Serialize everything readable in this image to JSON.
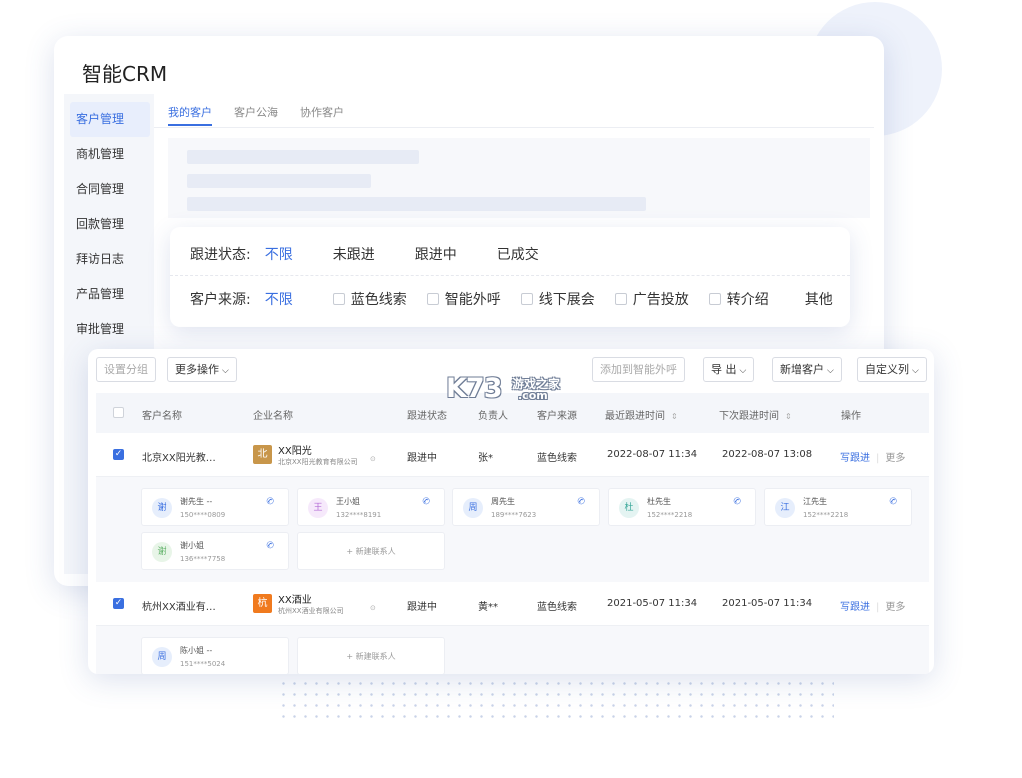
{
  "app": {
    "title": "智能CRM"
  },
  "sidebar": {
    "items": [
      {
        "label": "客户管理",
        "active": true
      },
      {
        "label": "商机管理"
      },
      {
        "label": "合同管理"
      },
      {
        "label": "回款管理"
      },
      {
        "label": "拜访日志"
      },
      {
        "label": "产品管理"
      },
      {
        "label": "审批管理"
      }
    ]
  },
  "tabs": [
    {
      "label": "我的客户",
      "active": true
    },
    {
      "label": "客户公海"
    },
    {
      "label": "协作客户"
    }
  ],
  "filters": {
    "follow_status": {
      "label": "跟进状态:",
      "options": [
        "不限",
        "未跟进",
        "跟进中",
        "已成交"
      ],
      "selected": "不限"
    },
    "source": {
      "label": "客户来源:",
      "all": "不限",
      "options": [
        "蓝色线索",
        "智能外呼",
        "线下展会",
        "广告投放",
        "转介绍"
      ],
      "other": "其他"
    }
  },
  "toolbar": {
    "set_group": "设置分组",
    "more_actions": "更多操作",
    "add_to_call": "添加到智能外呼",
    "export": "导 出",
    "new_customer": "新增客户",
    "custom_columns": "自定义列"
  },
  "table": {
    "headers": {
      "customer_name": "客户名称",
      "company_name": "企业名称",
      "follow_status": "跟进状态",
      "owner": "负责人",
      "source": "客户来源",
      "last_follow": "最近跟进时间",
      "next_follow": "下次跟进时间",
      "actions": "操作"
    },
    "rows": [
      {
        "customer": "北京XX阳光教…",
        "logo_char": "北",
        "logo_color": "#c8964a",
        "company": "XX阳光",
        "company_full": "北京XX阳光教育有限公司",
        "status": "跟进中",
        "owner": "张*",
        "source": "蓝色线索",
        "last_follow": "2022-08-07 11:34",
        "next_follow": "2022-08-07 13:08",
        "write_follow": "写跟进",
        "more": "更多",
        "contacts": [
          {
            "avatar": "谢",
            "name": "谢先生 --",
            "phone": "150****0809",
            "color": "#3a6fe0",
            "bg": "#e6eefc"
          },
          {
            "avatar": "王",
            "name": "王小姐",
            "phone": "132****8191",
            "color": "#b46cd6",
            "bg": "#f6e9fb"
          },
          {
            "avatar": "周",
            "name": "周先生",
            "phone": "189****7623",
            "color": "#3a6fe0",
            "bg": "#e6eefc"
          },
          {
            "avatar": "杜",
            "name": "杜先生",
            "phone": "152****2218",
            "color": "#3aa89a",
            "bg": "#e4f4f2"
          },
          {
            "avatar": "江",
            "name": "江先生",
            "phone": "152****2218",
            "color": "#3a6fe0",
            "bg": "#e6eefc"
          },
          {
            "avatar": "谢",
            "name": "谢小姐",
            "phone": "136****7758",
            "color": "#62b26a",
            "bg": "#e8f5e8"
          }
        ],
        "add_contact": "+ 新建联系人"
      },
      {
        "customer": "杭州XX酒业有…",
        "logo_char": "杭",
        "logo_color": "#f07a1e",
        "company": "XX酒业",
        "company_full": "杭州XX酒业有限公司",
        "status": "跟进中",
        "owner": "黄**",
        "source": "蓝色线索",
        "last_follow": "2021-05-07 11:34",
        "next_follow": "2021-05-07 11:34",
        "write_follow": "写跟进",
        "more": "更多",
        "contacts": [
          {
            "avatar": "周",
            "name": "陈小姐 --",
            "phone": "151****5024",
            "color": "#3a6fe0",
            "bg": "#e6eefc"
          }
        ],
        "add_contact": "+ 新建联系人"
      }
    ]
  },
  "watermark": {
    "brand": "K73",
    "cn": "游戏之家",
    "suffix": ".com"
  }
}
